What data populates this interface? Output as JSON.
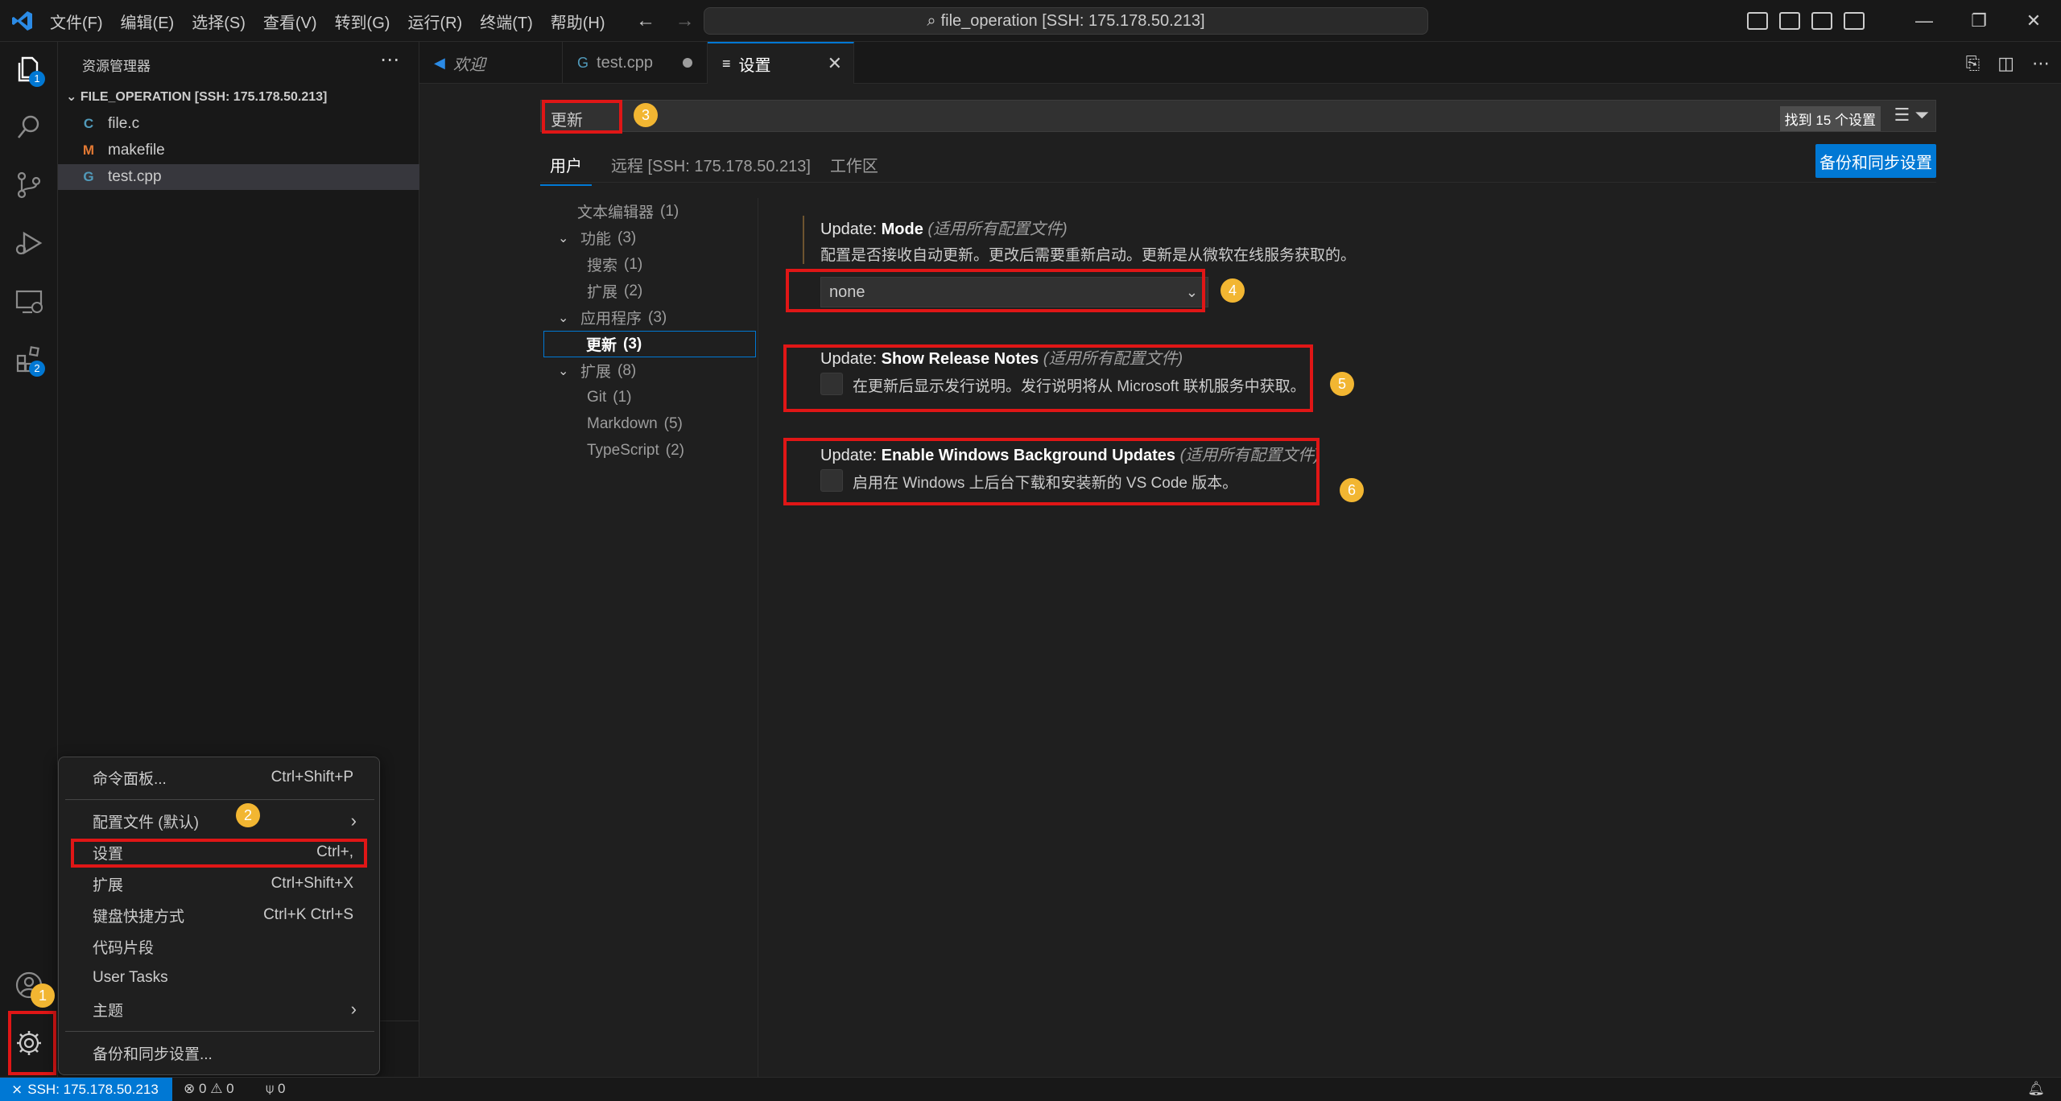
{
  "titlebar": {
    "menu": [
      "文件(F)",
      "编辑(E)",
      "选择(S)",
      "查看(V)",
      "转到(G)",
      "运行(R)",
      "终端(T)",
      "帮助(H)"
    ],
    "search": "file_operation [SSH: 175.178.50.213]"
  },
  "activity": {
    "explorer_badge": "1",
    "extensions_badge": "2"
  },
  "sidebar": {
    "title": "资源管理器",
    "folder": "FILE_OPERATION [SSH: 175.178.50.213]",
    "files": [
      {
        "icon": "C",
        "name": "file.c",
        "color": "#519aba"
      },
      {
        "icon": "M",
        "name": "makefile",
        "color": "#e37933"
      },
      {
        "icon": "G",
        "name": "test.cpp",
        "color": "#519aba"
      }
    ]
  },
  "tabs": [
    {
      "label": "欢迎"
    },
    {
      "label": "test.cpp"
    },
    {
      "label": "设置"
    }
  ],
  "settings": {
    "search_value": "更新",
    "found": "找到 15 个设置",
    "scopes": [
      "用户",
      "远程 [SSH: 175.178.50.213]",
      "工作区"
    ],
    "sync_button": "备份和同步设置",
    "toc": [
      {
        "label": "文本编辑器",
        "count": "(1)"
      },
      {
        "label": "功能",
        "count": "(3)"
      },
      {
        "label": "搜索",
        "count": "(1)"
      },
      {
        "label": "扩展",
        "count": "(2)"
      },
      {
        "label": "应用程序",
        "count": "(3)"
      },
      {
        "label": "更新",
        "count": "(3)"
      },
      {
        "label": "扩展",
        "count": "(8)"
      },
      {
        "label": "Git",
        "count": "(1)"
      },
      {
        "label": "Markdown",
        "count": "(5)"
      },
      {
        "label": "TypeScript",
        "count": "(2)"
      }
    ],
    "mode": {
      "prefix": "Update: ",
      "name": "Mode",
      "scope": "(适用所有配置文件)",
      "desc": "配置是否接收自动更新。更改后需要重新启动。更新是从微软在线服务获取的。",
      "value": "none"
    },
    "release_notes": {
      "prefix": "Update: ",
      "name": "Show Release Notes",
      "scope": "(适用所有配置文件)",
      "desc": "在更新后显示发行说明。发行说明将从 Microsoft 联机服务中获取。"
    },
    "bg_updates": {
      "prefix": "Update: ",
      "name": "Enable Windows Background Updates",
      "scope": "(适用所有配置文件)",
      "desc": "启用在 Windows 上后台下载和安装新的 VS Code 版本。"
    }
  },
  "menu": {
    "items": [
      {
        "label": "命令面板...",
        "kb": "Ctrl+Shift+P"
      },
      {
        "label": "配置文件 (默认)",
        "kb": ""
      },
      {
        "label": "设置",
        "kb": "Ctrl+,"
      },
      {
        "label": "扩展",
        "kb": "Ctrl+Shift+X"
      },
      {
        "label": "键盘快捷方式",
        "kb": "Ctrl+K Ctrl+S"
      },
      {
        "label": "代码片段",
        "kb": ""
      },
      {
        "label": "User Tasks",
        "kb": ""
      },
      {
        "label": "主题",
        "kb": ""
      },
      {
        "label": "备份和同步设置...",
        "kb": ""
      }
    ]
  },
  "markers": [
    "1",
    "2",
    "3",
    "4",
    "5",
    "6"
  ],
  "statusbar": {
    "remote": "SSH: 175.178.50.213",
    "errors": "0",
    "warnings": "0",
    "ports": "0"
  }
}
